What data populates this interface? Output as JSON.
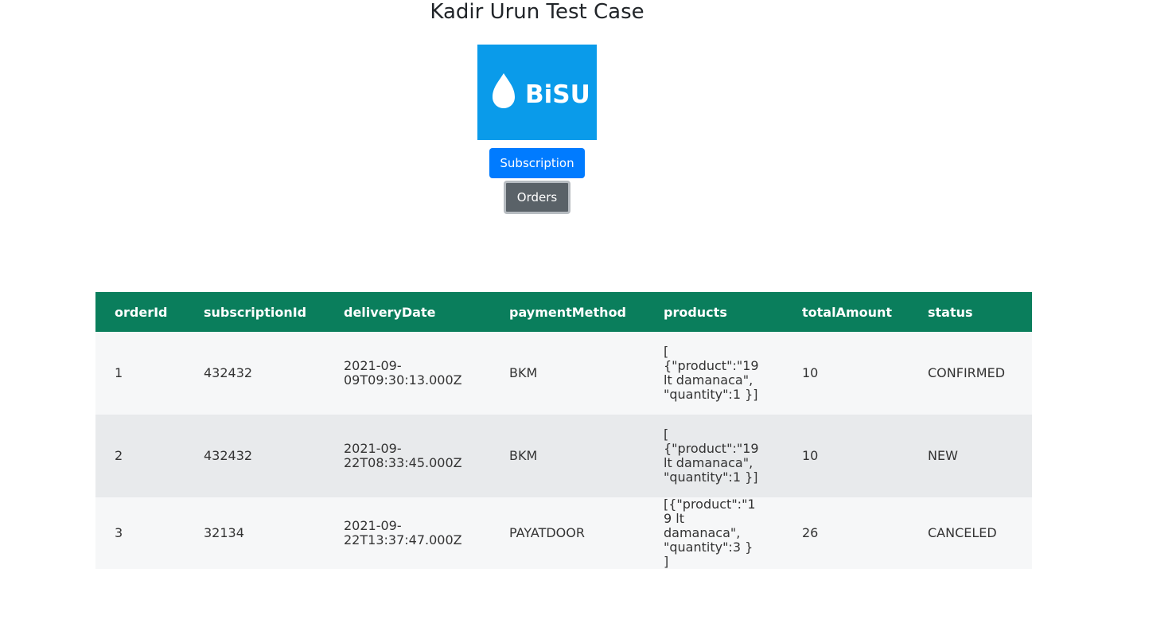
{
  "page": {
    "title": "Kadir Urun Test Case"
  },
  "logo": {
    "text": "BiSU",
    "background": "#0a9bea",
    "icon": "water-drop-icon"
  },
  "buttons": {
    "subscription_label": "Subscription",
    "orders_label": "Orders"
  },
  "colors": {
    "primary": "#007bff",
    "secondary": "#5a6268",
    "table_header": "#0a7e5c"
  },
  "table": {
    "columns": [
      "orderId",
      "subscriptionId",
      "deliveryDate",
      "paymentMethod",
      "products",
      "totalAmount",
      "status"
    ],
    "rows": [
      {
        "orderId": "1",
        "subscriptionId": "432432",
        "deliveryDate": "2021-09-09T09:30:13.000Z",
        "paymentMethod": "BKM",
        "products": "[ {\"product\":\"19 lt damanaca\", \"quantity\":1 }]",
        "totalAmount": "10",
        "status": "CONFIRMED"
      },
      {
        "orderId": "2",
        "subscriptionId": "432432",
        "deliveryDate": "2021-09-22T08:33:45.000Z",
        "paymentMethod": "BKM",
        "products": "[ {\"product\":\"19 lt damanaca\", \"quantity\":1 }]",
        "totalAmount": "10",
        "status": "NEW"
      },
      {
        "orderId": "3",
        "subscriptionId": "32134",
        "deliveryDate": "2021-09-22T13:37:47.000Z",
        "paymentMethod": "PAYATDOOR",
        "products": "[{\"product\":\"19 lt damanaca\", \"quantity\":3 } ]",
        "totalAmount": "26",
        "status": "CANCELED"
      }
    ]
  }
}
